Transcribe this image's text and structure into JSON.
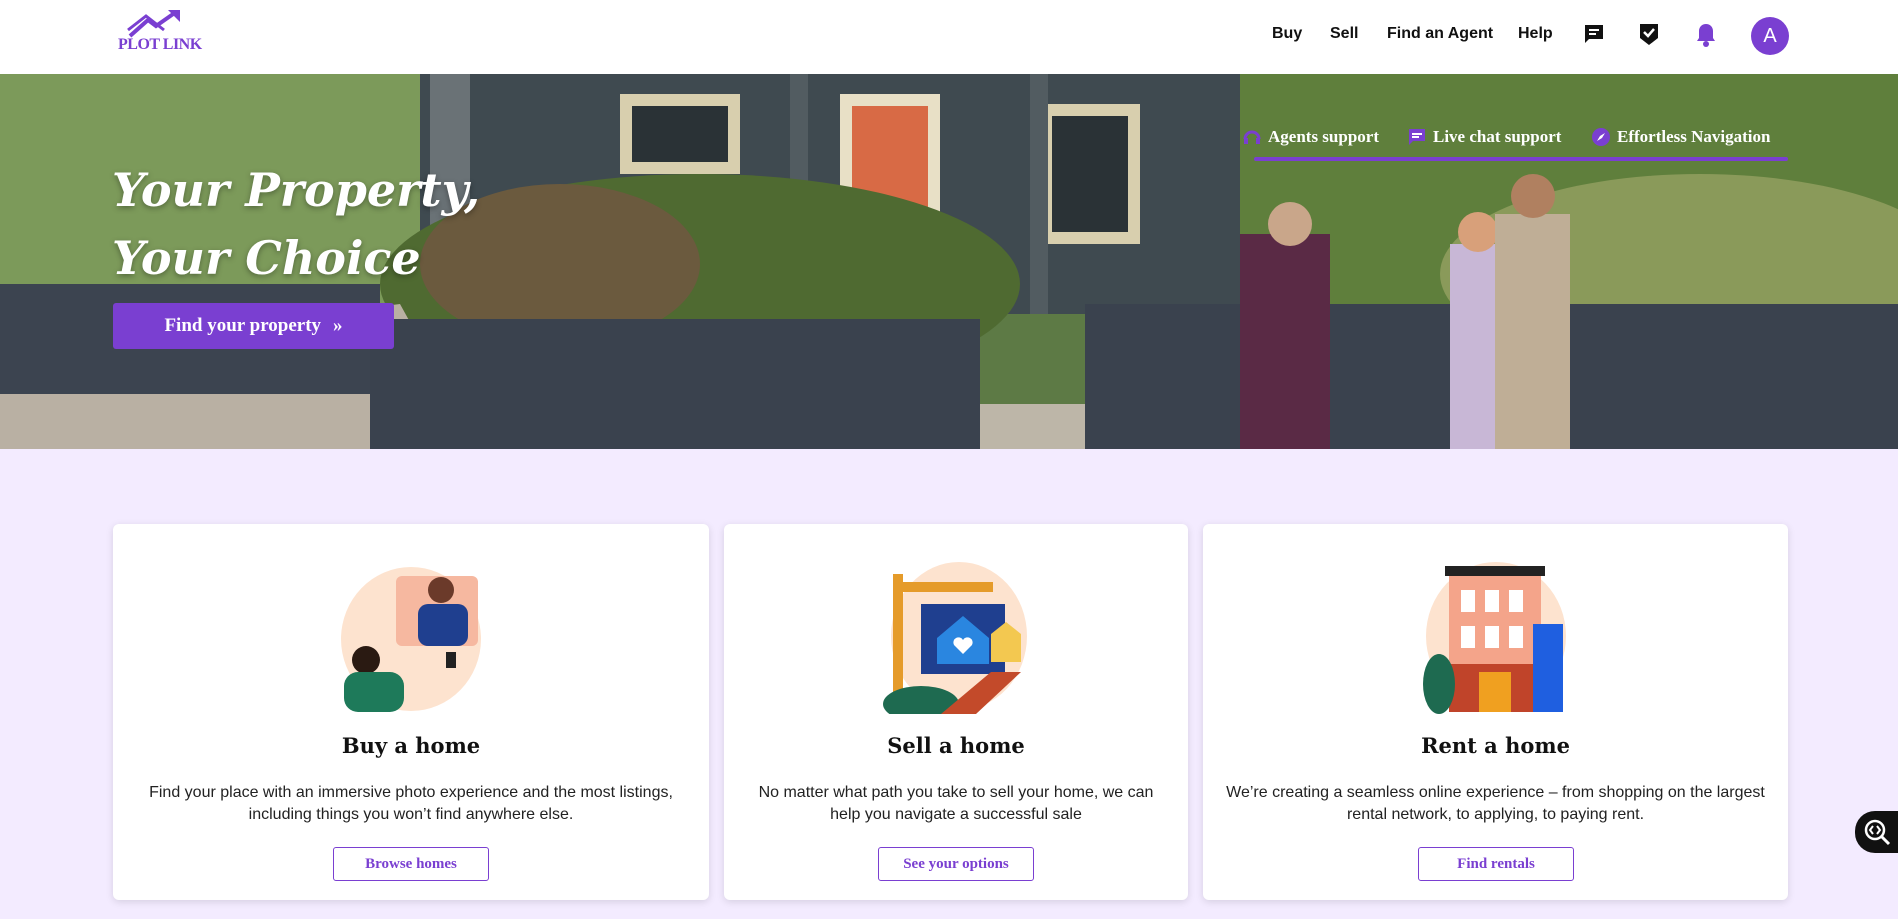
{
  "header": {
    "logo_text": "PLOT LINK",
    "nav": [
      {
        "label": "Buy"
      },
      {
        "label": "Sell"
      },
      {
        "label": "Find an Agent"
      },
      {
        "label": "Help"
      }
    ],
    "icons": [
      "chat-icon",
      "checklist-icon",
      "bell-icon"
    ],
    "avatar_initial": "A"
  },
  "hero": {
    "title_line1": "Your Property,",
    "title_line2": "Your Choice",
    "cta_label": "Find your property",
    "cta_icon": "double-chevron-right-icon",
    "features": [
      {
        "label": "Agents support",
        "icon": "headset-icon"
      },
      {
        "label": "Live chat support",
        "icon": "chat-bubble-icon"
      },
      {
        "label": "Effortless Navigation",
        "icon": "compass-icon"
      }
    ]
  },
  "cards": [
    {
      "title": "Buy a home",
      "text": "Find your place with an immersive photo experience and the most listings, including things you won’t find anywhere else.",
      "button": "Browse homes"
    },
    {
      "title": "Sell a home",
      "text": "No matter what path you take to sell your home, we can help you navigate a successful sale",
      "button": "See your options"
    },
    {
      "title": "Rent a home",
      "text": "We’re creating a seamless online experience – from shopping on the largest rental network, to applying, to paying rent.",
      "button": "Find rentals"
    }
  ],
  "colors": {
    "accent": "#7a3fd1",
    "page_background": "#f3ebff",
    "header_background": "#ffffff"
  }
}
